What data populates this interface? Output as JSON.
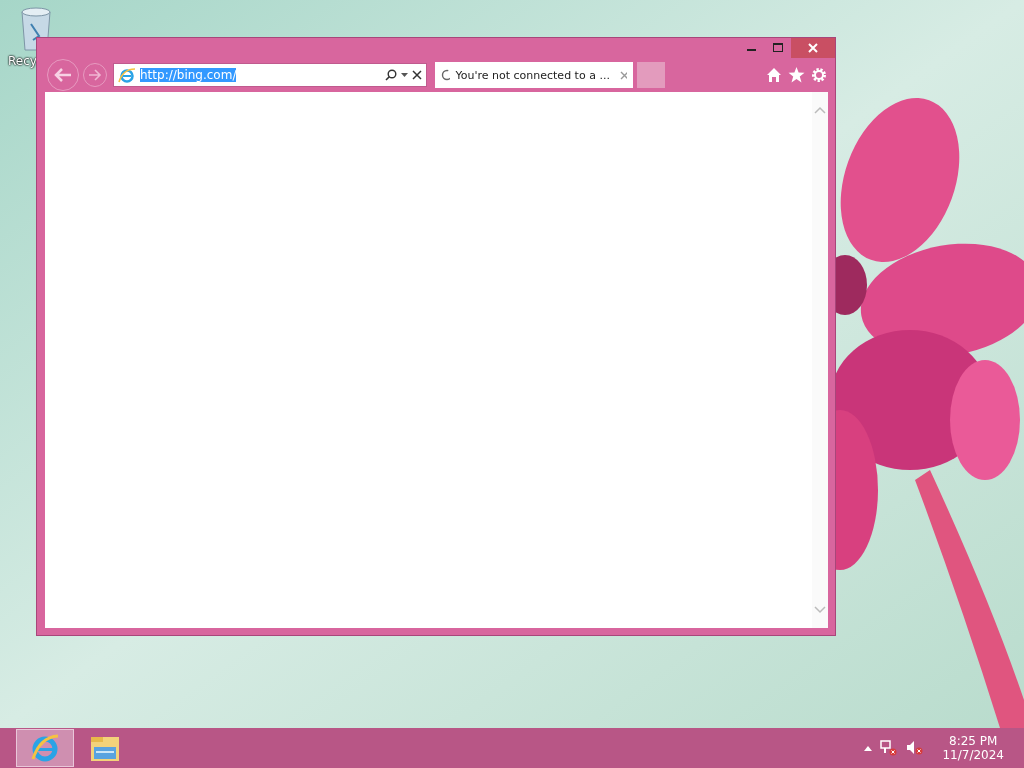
{
  "desktop": {
    "icons": [
      {
        "kind": "recycle-bin",
        "label": "Recy"
      }
    ]
  },
  "browser": {
    "address": {
      "value": "http://bing.com/",
      "selected": true
    },
    "tabs": [
      {
        "title": "You're not connected to a ...",
        "selected": true
      }
    ]
  },
  "taskbar": {
    "items": [
      {
        "kind": "browser",
        "selected": true
      },
      {
        "kind": "folder",
        "selected": false
      }
    ],
    "clock": {
      "time": "8:25 PM",
      "date": "11/7/2024"
    }
  }
}
